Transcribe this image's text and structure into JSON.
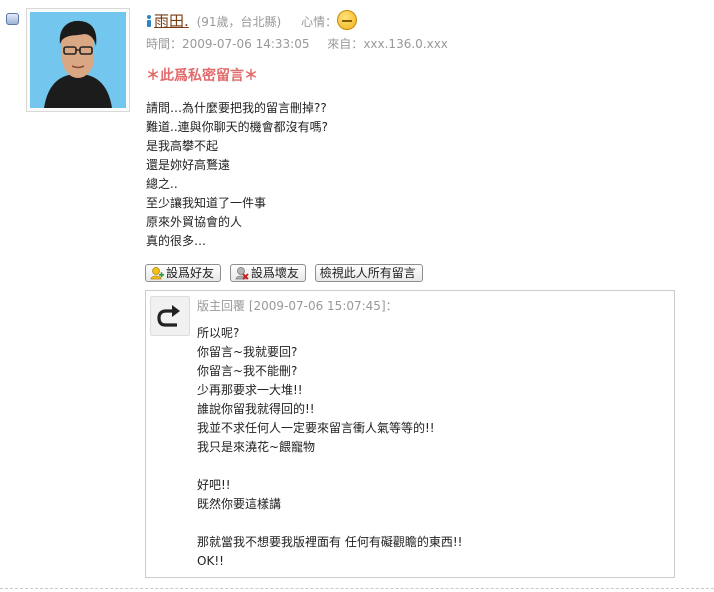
{
  "entry": {
    "name": "雨田.",
    "age_location": "(91歲，台北縣)",
    "mood_label": "心情：",
    "mood_icon": "sad-face-icon",
    "time_label": "時間：",
    "time": "2009-07-06 14:33:05",
    "from_label": "來自：",
    "from": "xxx.136.0.xxx",
    "private_note": "＊此爲私密留言＊",
    "message_lines": [
      "請問…為什麼要把我的留言刪掉??",
      "難道..連與你聊天的機會都沒有嗎?",
      "是我高攀不起",
      "還是妳好高鶩遠",
      "總之..",
      "至少讓我知道了一件事",
      "原來外貿協會的人",
      "真的很多…"
    ]
  },
  "actions": {
    "add_friend": "設爲好友",
    "set_enemy": "設爲壞友",
    "view_all": "檢視此人所有留言"
  },
  "reply": {
    "header": "版主回覆 [2009-07-06 15:07:45]：",
    "lines": [
      "所以呢?",
      "你留言~我就要回?",
      "你留言~我不能刪?",
      "少再那要求一大堆!!",
      "誰說你留我就得回的!!",
      "我並不求任何人一定要來留言衝人氣等等的!!",
      "我只是來澆花~餵寵物",
      "",
      "好吧!!",
      "既然你要這樣講",
      "",
      "那就當我不想要我版裡面有 任何有礙觀瞻的東西!!",
      "OK!!"
    ]
  },
  "colors": {
    "name": "#7a3b12",
    "private_note": "#e26b6b",
    "meta": "#999999",
    "avatar_bg": "#6fc2ec"
  }
}
